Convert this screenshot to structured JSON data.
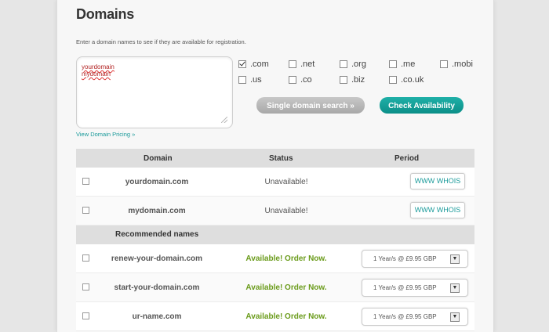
{
  "header": {
    "title": "Domains",
    "subtitle": "Enter a domain names to see if they are available for registration."
  },
  "search": {
    "textarea_value": "yourdomain\nmydomain",
    "pricing_link": "View Domain Pricing »"
  },
  "tlds": [
    {
      "label": ".com",
      "checked": true
    },
    {
      "label": ".net",
      "checked": false
    },
    {
      "label": ".org",
      "checked": false
    },
    {
      "label": ".me",
      "checked": false
    },
    {
      "label": ".mobi",
      "checked": false
    },
    {
      "label": ".us",
      "checked": false
    },
    {
      "label": ".co",
      "checked": false
    },
    {
      "label": ".biz",
      "checked": false
    },
    {
      "label": ".co.uk",
      "checked": false
    }
  ],
  "buttons": {
    "single_search": "Single domain search »",
    "check": "Check Availability"
  },
  "table": {
    "headers": [
      "Domain",
      "Status",
      "Period"
    ],
    "rows": [
      {
        "domain": "yourdomain.com",
        "status": "Unavailable!",
        "whois": "WWW WHOIS"
      },
      {
        "domain": "mydomain.com",
        "status": "Unavailable!",
        "whois": "WWW WHOIS"
      }
    ],
    "recommended_title": "Recommended names",
    "recommended": [
      {
        "domain": "renew-your-domain.com",
        "status": "Available! Order Now.",
        "period": "1 Year/s @ £9.95 GBP"
      },
      {
        "domain": "start-your-domain.com",
        "status": "Available! Order Now.",
        "period": "1 Year/s @ £9.95 GBP"
      },
      {
        "domain": "ur-name.com",
        "status": "Available! Order Now.",
        "period": "1 Year/s @ £9.95 GBP"
      }
    ]
  },
  "colors": {
    "accent": "#0c8f88",
    "available": "#6a9b1a",
    "link": "#1a9a9a"
  }
}
